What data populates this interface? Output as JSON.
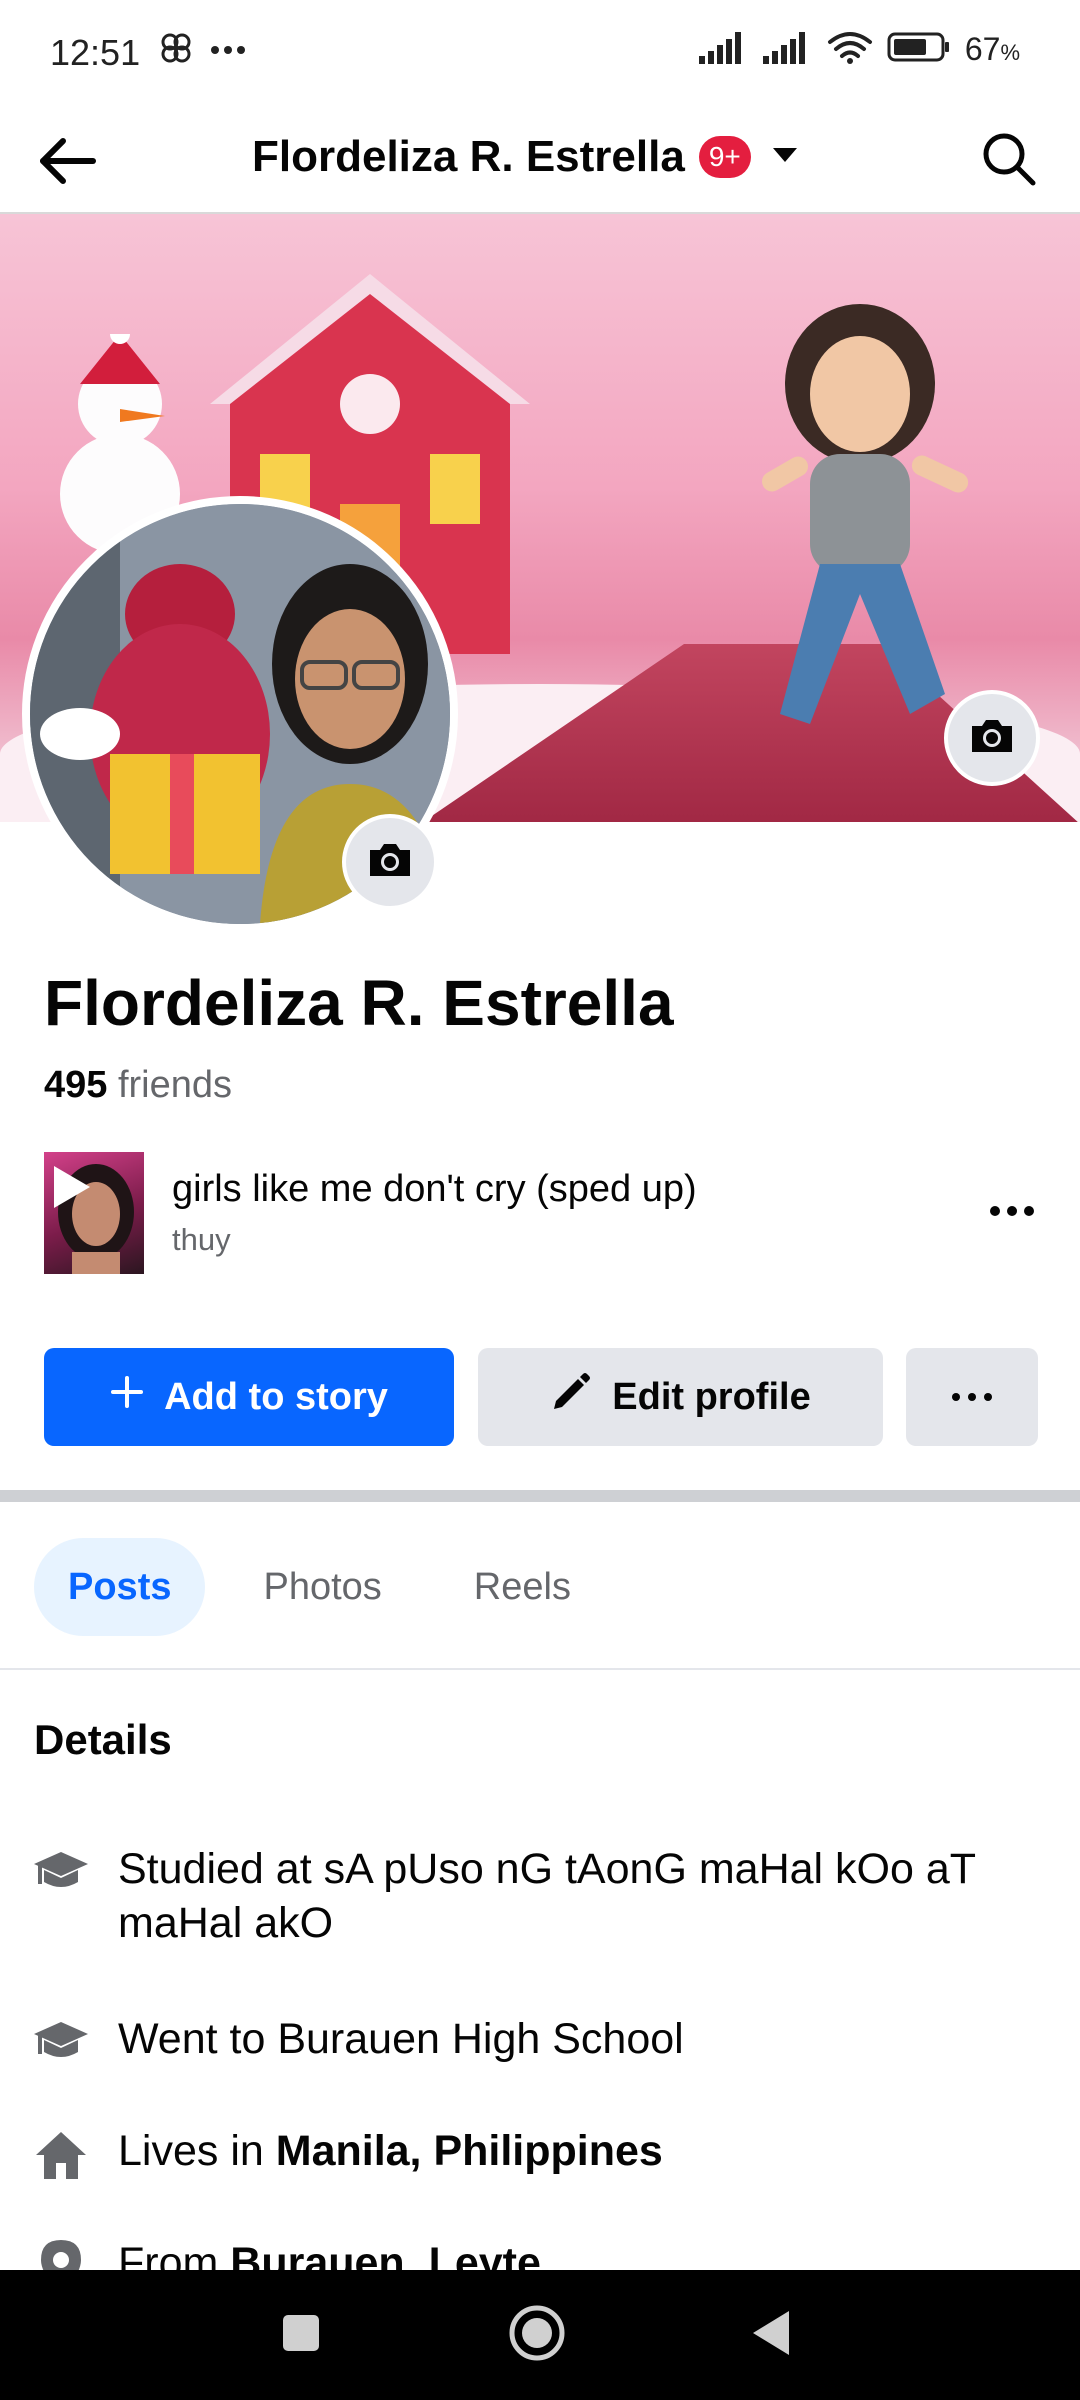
{
  "status_bar": {
    "time": "12:51",
    "battery_percent": "67",
    "battery_unit": "%",
    "icons": [
      "pinwheel-icon",
      "more-icon",
      "signal-icon",
      "signal-icon",
      "wifi-icon",
      "battery-icon"
    ]
  },
  "top_bar": {
    "title": "Flordeliza R. Estrella",
    "badge": "9+",
    "icons": [
      "back-arrow-icon",
      "caret-down-icon",
      "search-icon"
    ]
  },
  "profile": {
    "name": "Flordeliza R. Estrella",
    "friends_count": "495",
    "friends_label": "friends"
  },
  "music": {
    "title": "girls like me don't cry (sped up)",
    "artist": "thuy"
  },
  "actions": {
    "add_story": "Add to story",
    "edit_profile": "Edit profile"
  },
  "tabs": [
    {
      "label": "Posts",
      "active": true
    },
    {
      "label": "Photos",
      "active": false
    },
    {
      "label": "Reels",
      "active": false
    }
  ],
  "details": {
    "heading": "Details",
    "items": [
      {
        "icon": "graduation-cap-icon",
        "prefix": "Studied at sA pUso nG tAonG maHal kOo aT maHal akO",
        "bold": ""
      },
      {
        "icon": "graduation-cap-icon",
        "prefix": "Went to Burauen High School",
        "bold": ""
      },
      {
        "icon": "home-icon",
        "prefix": "Lives in ",
        "bold": "Manila, Philippines"
      },
      {
        "icon": "location-pin-icon",
        "prefix": "From ",
        "bold": "Burauen, Leyte"
      }
    ]
  },
  "colors": {
    "primary": "#0866ff",
    "badge": "#e41e3f",
    "secondary_button": "#e4e6eb",
    "muted_text": "#65676b"
  }
}
